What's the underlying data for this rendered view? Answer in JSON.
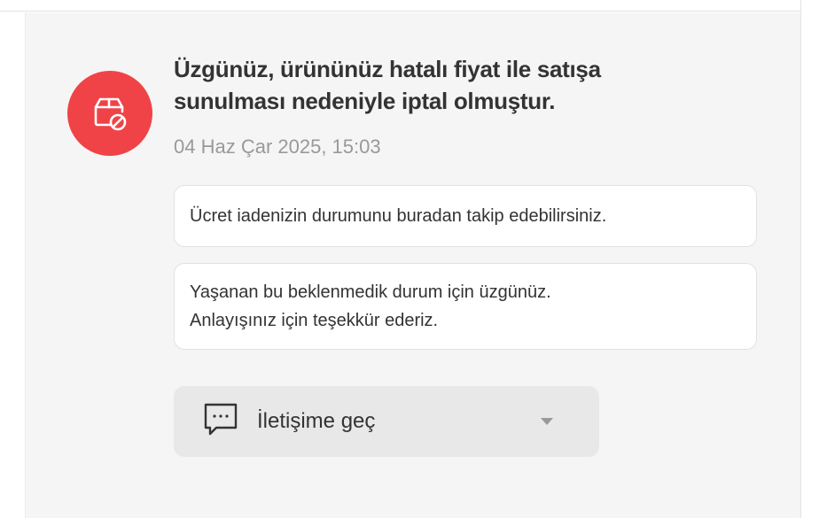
{
  "notification": {
    "icon": "package-cancelled-icon",
    "accent_color": "#f04347",
    "title_line_1": "Üzgünüz, ürününüz hatalı fiyat ile satışa",
    "title_line_2": "sunulması nedeniyle iptal olmuştur.",
    "timestamp": "04 Haz Çar 2025, 15:03"
  },
  "messages": [
    {
      "lines": [
        "Ücret iadenizin durumunu buradan takip edebilirsiniz."
      ]
    },
    {
      "lines": [
        "Yaşanan bu beklenmedik durum için üzgünüz.",
        "Anlayışınız için teşekkür ederiz."
      ]
    }
  ],
  "contact": {
    "label": "İletişime geç",
    "icon": "chat-bubble-icon",
    "dropdown_icon": "chevron-down-icon"
  }
}
